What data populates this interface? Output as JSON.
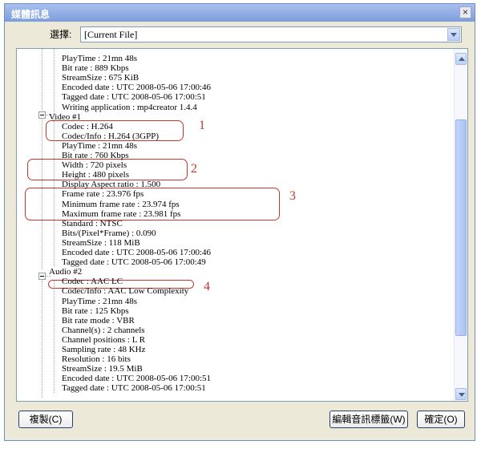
{
  "window": {
    "title": "媒體訊息",
    "close_symbol": "×"
  },
  "selector": {
    "label": "選擇:",
    "value": "[Current File]"
  },
  "tree_rows": [
    "PlayTime : 21mn 48s",
    "Bit rate : 889 Kbps",
    "StreamSize : 675 KiB",
    "Encoded date : UTC 2008-05-06 17:00:46",
    "Tagged date : UTC 2008-05-06 17:00:51",
    "Writing application : mp4creator 1.4.4",
    "Video #1",
    "Codec : H.264",
    "Codec/Info : H.264 (3GPP)",
    "PlayTime : 21mn 48s",
    "Bit rate : 760 Kbps",
    "Width : 720 pixels",
    "Height : 480 pixels",
    "Display Aspect ratio : 1.500",
    "Frame rate : 23.976 fps",
    "Minimum frame rate : 23.974 fps",
    "Maximum frame rate : 23.981 fps",
    "Standard : NTSC",
    "Bits/(Pixel*Frame) : 0.090",
    "StreamSize : 118 MiB",
    "Encoded date : UTC 2008-05-06 17:00:46",
    "Tagged date : UTC 2008-05-06 17:00:49",
    "Audio #2",
    "Codec : AAC LC",
    "Codec/Info : AAC Low Complexity",
    "PlayTime : 21mn 48s",
    "Bit rate : 125 Kbps",
    "Bit rate mode : VBR",
    "Channel(s) : 2 channels",
    "Channel positions : L R",
    "Sampling rate : 48 KHz",
    "Resolution : 16 bits",
    "StreamSize : 19.5 MiB",
    "Encoded date : UTC 2008-05-06 17:00:51",
    "Tagged date : UTC 2008-05-06 17:00:51"
  ],
  "callouts": [
    "1",
    "2",
    "3",
    "4"
  ],
  "buttons": {
    "copy": "複製(C)",
    "edit_tags": "編輯音訊標籤(W)",
    "ok": "確定(O)"
  },
  "colors": {
    "annotation": "#c0392b",
    "title_bar": "#7d9ddb"
  }
}
